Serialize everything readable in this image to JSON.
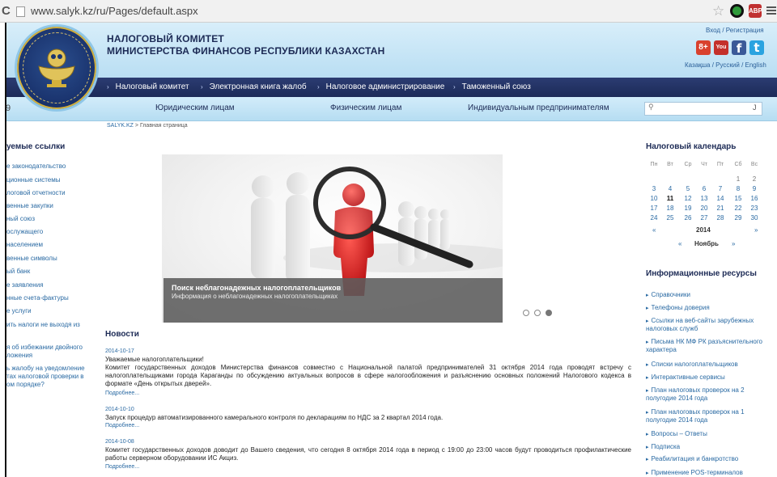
{
  "browser": {
    "back": "C",
    "url": "www.salyk.kz/ru/Pages/default.aspx",
    "star": "☆",
    "ext_badge": "ABP"
  },
  "header": {
    "title_line1": "НАЛОГОВЫЙ КОМИТЕТ",
    "title_line2": "МИНИСТЕРСТВА ФИНАНСОВ РЕСПУБЛИКИ КАЗАХСТАН",
    "login": "Вход / Регистрация",
    "languages": "Казақша / Русский / English",
    "social": {
      "gplus": "8+",
      "youtube": "You",
      "facebook": "f",
      "twitter": "t"
    }
  },
  "nav": {
    "items": [
      "Налоговый комитет",
      "Электронная книга жалоб",
      "Налоговое администрирование",
      "Таможенный союз"
    ]
  },
  "subnav": {
    "left_glyph": "9",
    "items": [
      "Юридическим лицам",
      "Физическим лицам",
      "Индивидуальным предпринимателям"
    ],
    "search_end": "J"
  },
  "breadcrumb": {
    "root": "SALYK.KZ",
    "separator": " > ",
    "current": "Главная страница"
  },
  "left": {
    "heading": "уемые ссылки",
    "links": [
      "е законодательство",
      "ционные системы",
      "логовой отчетности",
      "венные закупки",
      "ный союз",
      "ослужащего",
      "населением",
      "венные символы",
      "ый банк",
      "е заявления",
      "нные счета-фактуры",
      "е услуги",
      "ить налоги не выходя из",
      "я об избежании двойного\nложения",
      "ь жалобу на уведомление\nтах налоговой проверки в\nом порядке?"
    ]
  },
  "banner": {
    "caption_title": "Поиск неблагонадежных налогоплательщиков",
    "caption_sub": "Информация о неблагонадежных налогоплательщиках",
    "slides_total": 3,
    "active_slide": 3
  },
  "news": {
    "heading": "Новости",
    "more_label": "Подробнее...",
    "items": [
      {
        "date": "2014-10-17",
        "text": "Уважаемые налогоплательщики!\nКомитет государственных доходов Министерства финансов совместно с Национальной палатой предпринимателей 31 октября 2014 года проводят встречу с налогоплательщиками города Караганды по обсуждению актуальных вопросов в сфере налогообложения и разъяснению основных положений Налогового кодекса в формате «День открытых дверей»."
      },
      {
        "date": "2014-10-10",
        "text": "Запуск процедур автоматизированного камерального контроля по декларациям по НДС за 2 квартал 2014 года."
      },
      {
        "date": "2014-10-08",
        "text": "Комитет государственных доходов доводит до Вашего сведения, что сегодня 8 октября 2014 года в период с 19:00 до 23:00 часов будут проводиться профилактические работы серверном оборудовании ИС Акциз."
      }
    ]
  },
  "calendar": {
    "heading": "Налоговый календарь",
    "weekdays": [
      "Пн",
      "Вт",
      "Ср",
      "Чт",
      "Пт",
      "Сб",
      "Вс"
    ],
    "weeks": [
      [
        "",
        "",
        "",
        "",
        "",
        "1",
        "2"
      ],
      [
        "3",
        "4",
        "5",
        "6",
        "7",
        "8",
        "9"
      ],
      [
        "10",
        "11",
        "12",
        "13",
        "14",
        "15",
        "16"
      ],
      [
        "17",
        "18",
        "19",
        "20",
        "21",
        "22",
        "23"
      ],
      [
        "24",
        "25",
        "26",
        "27",
        "28",
        "29",
        "30"
      ]
    ],
    "today": "11",
    "year": "2014",
    "month": "Ноябрь",
    "prev_arrow": "«",
    "next_arrow": "»"
  },
  "info": {
    "heading": "Информационные ресурсы",
    "links": [
      "Справочники",
      "Телефоны доверия",
      "Ссылки на веб-сайты зарубежных налоговых служб",
      "Письма НК МФ РК разъяснительного характера",
      "Списки налогоплательщиков",
      "Интерактивные сервисы",
      "План налоговых проверок на 2 полугодие 2014 года",
      "План налоговых проверок на 1 полугодие 2014 года",
      "Вопросы – Ответы",
      "Подписка",
      "Реабилитация и банкротство",
      "Применение POS-терминалов"
    ]
  },
  "colors": {
    "nav": "#1c2a58",
    "header": "#c8e6f6",
    "link": "#2a6aa3",
    "heading": "#1c2a55"
  }
}
